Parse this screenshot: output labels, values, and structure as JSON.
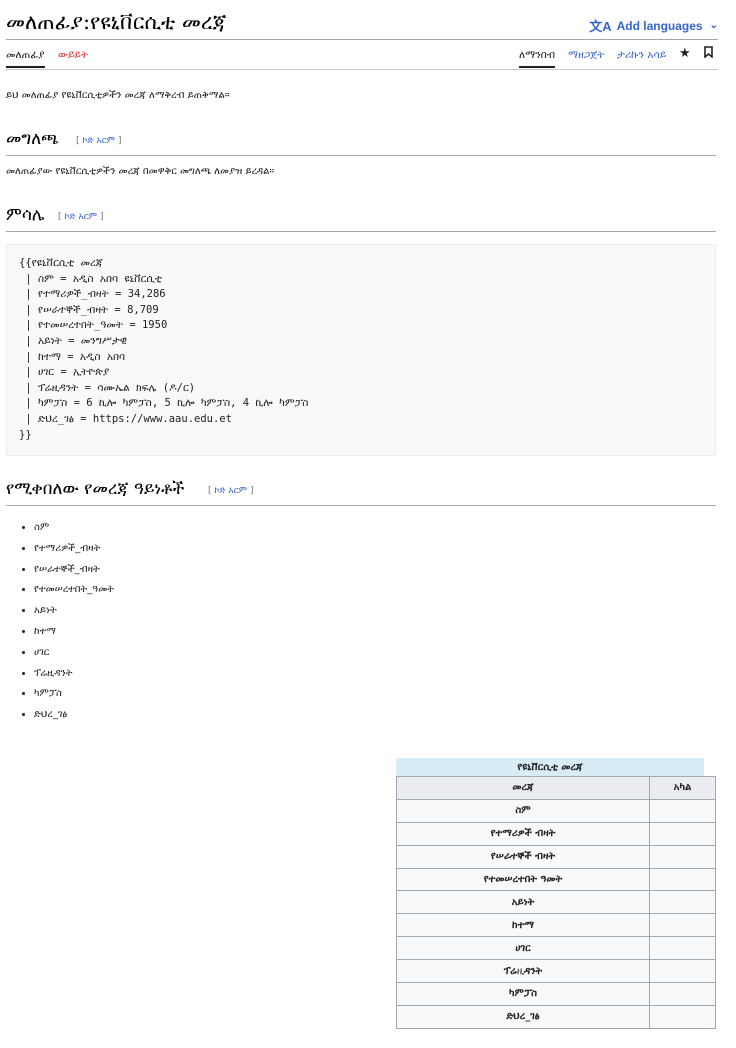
{
  "header": {
    "page_title": "መለጠፊያ:የዩኒቨርሲቲ መረጃ",
    "add_languages": "Add languages"
  },
  "tabs": {
    "left": [
      "መለጠፊያ",
      "ውይይት"
    ],
    "right": [
      "ለማንበብ",
      "ማዘጋጀት",
      "ታሪኩን አሳይ"
    ]
  },
  "intro": "ይህ መለጠፊያ የዩኒቨርሲቲዎችን መረጃ ለማቅረብ ይጠቅማል።",
  "sections": {
    "usage": {
      "heading": "መግለጫ",
      "edit": "ኮድ አርም",
      "text": "መለጠፊያው የዩኒቨርሲቲዎችን መረጃ በመዋቅር መግለጫ ለመያዝ ይረዳል።"
    },
    "example": {
      "heading": "ምሳሌ",
      "edit": "ኮድ አርም",
      "code": [
        "{{የዩኒቨርሲቲ መረጃ",
        " | ስም = አዲስ አበባ ዩኒቨርሲቲ",
        " | የተማሪዎች_ብዛት = 34,286",
        " | የሠራተኞች_ብዛት = 8,709",
        " | የተመሠረተበት_ዓመት = 1950",
        " | አይነት = መንግሥታዊ",
        " | ከተማ = አዲስ አበባ",
        " | ሀገር = ኢትዮጵያ",
        " | ፕሬዚዳንት = ሳሙኤል ክፍሌ (ዶ/ር)",
        " | ካምፓስ = 6 ኪሎ ካምፓስ, 5 ኪሎ ካምፓስ, 4 ኪሎ ካምፓስ",
        " | ድህረ_ገፅ = https://www.aau.edu.et",
        "}}"
      ]
    },
    "fields": {
      "heading": "የሚቀበለው የመረጃ ዓይነቶች",
      "edit": "ኮድ አርም",
      "items": [
        "ስም",
        "የተማሪዎች_ብዛት",
        "የሠራተኞች_ብዛት",
        "የተመሠረተበት_ዓመት",
        "አይነት",
        "ከተማ",
        "ሀገር",
        "ፕሬዚዳንት",
        "ካምፓስ",
        "ድህረ_ገፅ"
      ]
    }
  },
  "table": {
    "caption": "የዩኒቨርሲቲ መረጃ",
    "headers": [
      "መረጃ",
      "አካል"
    ],
    "rows": [
      "ስም",
      "የተማሪዎች ብዛት",
      "የሠራተኞች ብዛት",
      "የተመሠረተበት ዓመት",
      "አይነት",
      "ከተማ",
      "ሀገር",
      "ፕሬዚዳንት",
      "ካምፓስ",
      "ድህረ_ገፅ"
    ]
  }
}
